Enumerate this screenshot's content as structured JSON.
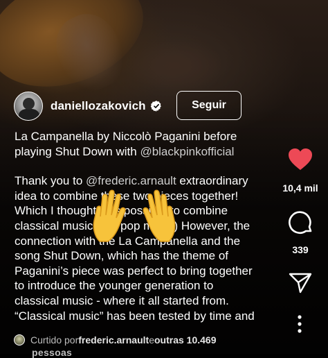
{
  "post": {
    "username": "daniellozakovich",
    "follow_label": "Seguir",
    "caption_line_1": "La Campanella by Niccolò Paganini before",
    "caption_line_2a": "playing Shut Down with ",
    "caption_line_2b": "@blackpinkofficial",
    "para2": {
      "l1a": "Thank you to ",
      "l1b": "@frederic.arnault",
      "l1c": " extraordinary",
      "l2": "idea to combine these two pieces together!",
      "l3": "Which I thought was possible to combine",
      "l4": "classical music with pop music) However, the",
      "l5": "connection with the La Campanella and the",
      "l6": "song Shut Down, which has the theme of",
      "l7": "Paganini’s piece was perfect to bring together",
      "l8": "to introduce the younger generation to",
      "l9": "classical music - where it all started from.",
      "l10": "“Classical music” has been tested by time and"
    }
  },
  "actions": {
    "likes": "10,4 mil",
    "comments": "339",
    "like_color": "#ed4956"
  },
  "footer": {
    "prefix": "Curtido por ",
    "liker": "frederic.arnault",
    "middle": " e ",
    "others": "outras 10.469",
    "line2": "pessoas"
  },
  "icons": [
    "verified-badge-icon",
    "heart-icon",
    "comment-icon",
    "share-icon",
    "more-icon",
    "raised-hands-emoji"
  ]
}
